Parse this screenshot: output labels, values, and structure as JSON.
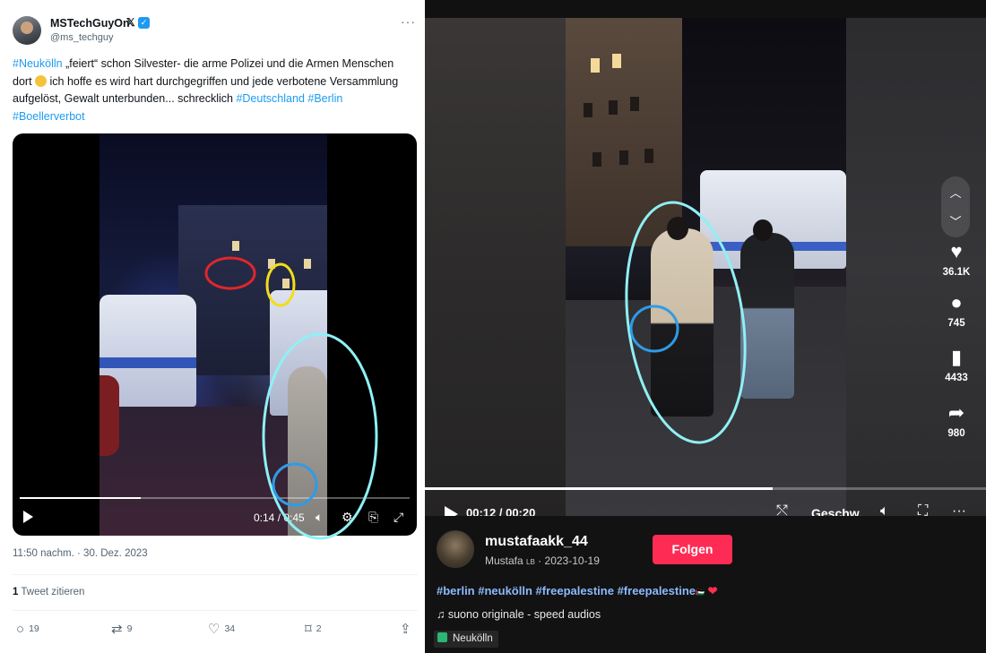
{
  "tweet": {
    "author_name": "MSTechGuyOn",
    "author_name_suffix": "𝕏",
    "handle": "@ms_techguy",
    "text_parts": [
      {
        "t": "#Neukölln",
        "tag": true
      },
      {
        "t": " „feiert“ schon Silvester- die arme Polizei und die Armen Menschen dort ",
        "tag": false
      },
      {
        "t": " ich hoffe es wird hart durchgegriffen und jede verbotene Versammlung aufgelöst, Gewalt unterbunden... schrecklich ",
        "tag": false
      },
      {
        "t": "#Deutschland",
        "tag": true
      },
      {
        "t": " ",
        "tag": false
      },
      {
        "t": "#Berlin",
        "tag": true
      },
      {
        "t": " ",
        "tag": false
      },
      {
        "t": "#Boellerverbot",
        "tag": true
      }
    ],
    "video": {
      "time": "0:14 / 0:45",
      "progress": 0.31
    },
    "date": "11:50 nachm. · 30. Dez. 2023",
    "quote_count": "1",
    "quote_label": "Tweet zitieren",
    "actions": {
      "replies": "19",
      "retweets": "9",
      "likes": "34",
      "bookmarks": "2"
    }
  },
  "tiktok": {
    "video": {
      "time": "00:12 / 00:20",
      "speed_label": "Geschw.",
      "progress": 0.62
    },
    "stats": {
      "likes": "36.1K",
      "comments": "745",
      "saves": "4433",
      "shares": "980"
    },
    "username": "mustafaakk_44",
    "display_name": "Mustafa",
    "display_badge": "LB",
    "post_date": "2023-10-19",
    "follow_label": "Folgen",
    "hashtags": "#berlin #neukölln #freepalestine #freepalestine",
    "hashtag_suffix": "🇵🇸",
    "sound": "suono originale - speed audios",
    "location": "Neukölln"
  },
  "colors": {
    "twitter_blue": "#1d9bf0",
    "follow_red": "#fe2c55",
    "tiktok_tag_blue": "#8cb9ff",
    "annotation_red": "#e0262c",
    "annotation_yellow": "#f2dd1b",
    "annotation_cyan": "#8ff0f5",
    "annotation_blue": "#2f9be6"
  },
  "icons": [
    "verified-badge-icon",
    "more-icon",
    "play-icon",
    "volume-icon",
    "settings-icon",
    "pip-icon",
    "fullscreen-icon",
    "reply-icon",
    "retweet-icon",
    "like-icon",
    "bookmark-icon",
    "share-icon",
    "chevron-up-icon",
    "chevron-down-icon",
    "heart-icon",
    "comment-icon",
    "save-icon",
    "forward-icon",
    "no-float-icon",
    "music-note-icon",
    "location-pin-icon"
  ]
}
